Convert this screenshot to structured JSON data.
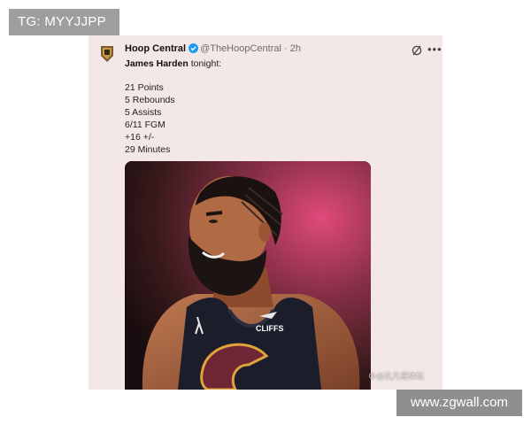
{
  "overlay": {
    "tg_label": "TG: MYYJJPP",
    "site_label": "www.zgwall.com"
  },
  "tweet": {
    "author_name": "Hoop Central",
    "handle": "@TheHoopCentral",
    "separator": "·",
    "time": "2h",
    "mention": "James Harden",
    "text_suffix": " tonight:",
    "stats": [
      "21 Points",
      "5 Rebounds",
      "5 Assists",
      "6/11 FGM",
      "+16 +/-",
      "29 Minutes"
    ],
    "icons": [
      "team-logo-avatar",
      "verified-icon",
      "grok-icon",
      "more-icon"
    ],
    "media": {
      "jersey_text": "CLIFFS",
      "watermark": "⊗@孔凡哥体坛"
    }
  },
  "colors": {
    "card_bg": "#f4e8e6",
    "verified_blue": "#1d9bf0",
    "jersey_navy": "#1b1d2b",
    "jersey_wine": "#6f2634",
    "jersey_gold": "#e0a33a"
  }
}
